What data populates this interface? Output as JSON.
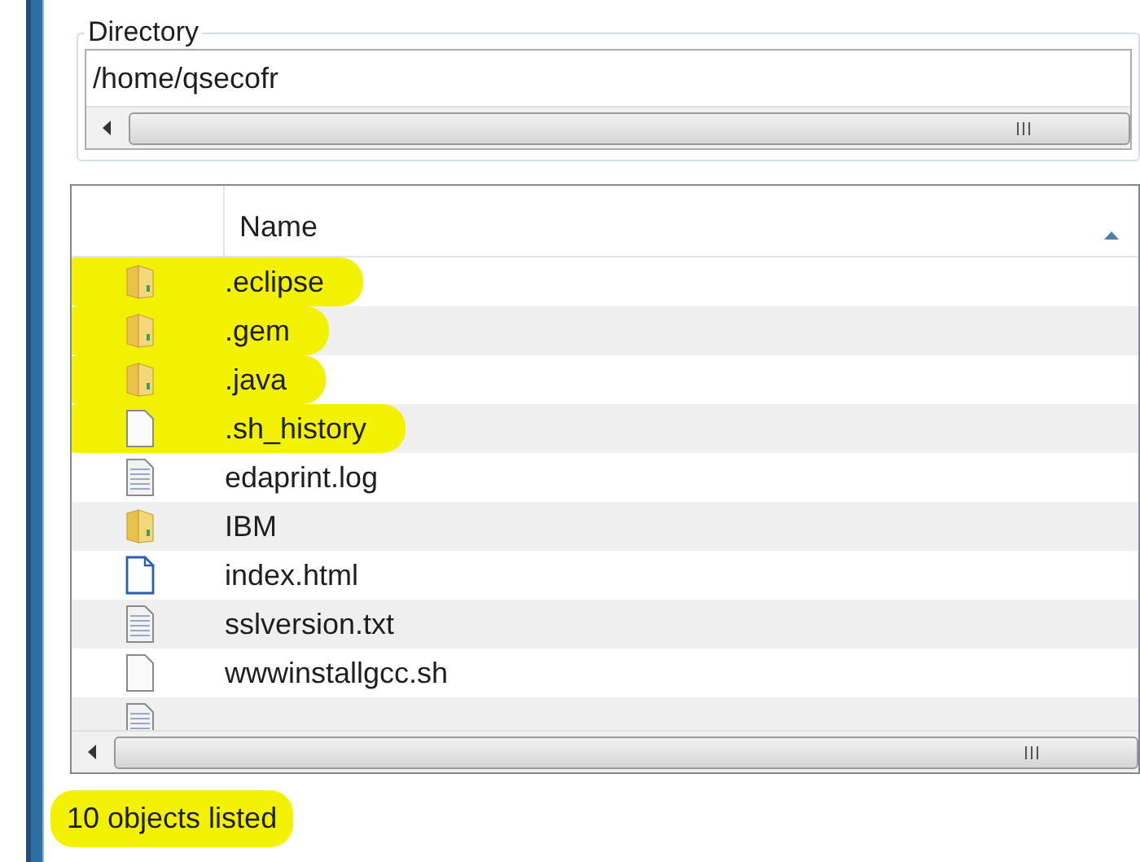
{
  "directory": {
    "label": "Directory",
    "value": "/home/qsecofr"
  },
  "file_list": {
    "columns": [
      "Name"
    ],
    "rows": [
      {
        "kind": "folder",
        "name": ".eclipse",
        "highlighted": true
      },
      {
        "kind": "folder",
        "name": ".gem",
        "highlighted": true
      },
      {
        "kind": "folder",
        "name": ".java",
        "highlighted": true
      },
      {
        "kind": "file",
        "name": ".sh_history",
        "highlighted": true
      },
      {
        "kind": "text",
        "name": "edaprint.log",
        "highlighted": false
      },
      {
        "kind": "folder",
        "name": "IBM",
        "highlighted": false
      },
      {
        "kind": "html",
        "name": "index.html",
        "highlighted": false
      },
      {
        "kind": "text",
        "name": "sslversion.txt",
        "highlighted": false
      },
      {
        "kind": "file",
        "name": "wwwinstallgcc.sh",
        "highlighted": false
      },
      {
        "kind": "text",
        "highlighted": false
      }
    ]
  },
  "status_bar": {
    "text": "10 objects listed",
    "highlighted": true
  }
}
